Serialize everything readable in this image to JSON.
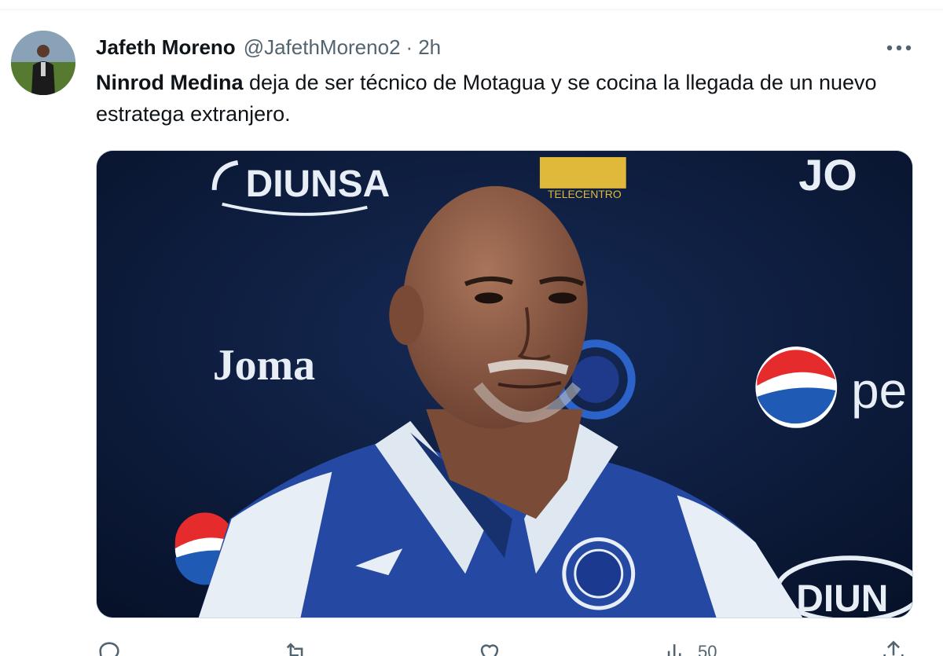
{
  "tweet": {
    "author_name": "Jafeth Moreno",
    "author_handle": "@JafethMoreno2",
    "separator": "·",
    "timestamp": "2h",
    "text_bold": "Ninrod Medina",
    "text_rest": " deja de ser técnico de Motagua y se cocina la llegada de un nuevo estratega extranjero."
  },
  "media": {
    "backdrop_logos": [
      "DIUNSA",
      "Joma",
      "JO",
      "pe",
      "DIUN",
      "TELECENTRO"
    ],
    "colors": {
      "backdrop": "#0d1b3a",
      "shirt_blue": "#1f3a8a",
      "collar": "#dfe8f0"
    }
  },
  "actions": {
    "reply_icon": "reply-icon",
    "retweet_icon": "retweet-icon",
    "like_icon": "heart-icon",
    "views_icon": "views-icon",
    "views_count": "50",
    "share_icon": "share-icon"
  },
  "colors": {
    "text": "#0f1419",
    "secondary": "#536471",
    "divider": "#eff3f4"
  }
}
